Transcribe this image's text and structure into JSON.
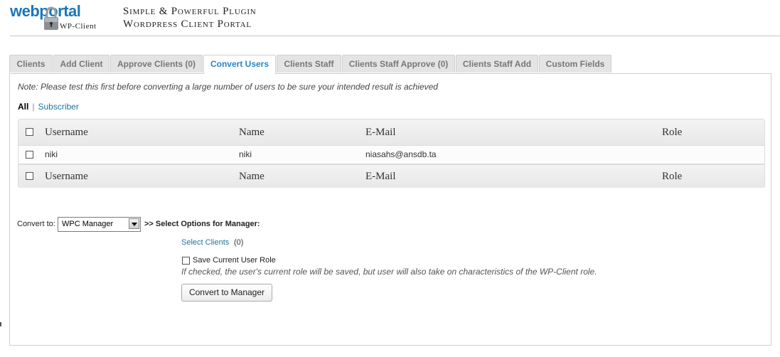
{
  "brand": {
    "logo_web": "web",
    "logo_portal": "portal",
    "logo_sub": "WP-Client",
    "tagline_line1": "Simple & Powerful Plugin",
    "tagline_line2": "Wordpress Client Portal",
    "accent_color": "#1a76b8"
  },
  "tabs": [
    {
      "label": "Clients",
      "active": false
    },
    {
      "label": "Add Client",
      "active": false
    },
    {
      "label": "Approve Clients (0)",
      "active": false
    },
    {
      "label": "Convert Users",
      "active": true
    },
    {
      "label": "Clients Staff",
      "active": false
    },
    {
      "label": "Clients Staff Approve (0)",
      "active": false
    },
    {
      "label": "Clients Staff Add",
      "active": false
    },
    {
      "label": "Custom Fields",
      "active": false
    }
  ],
  "note": "Note: Please test this first before converting a large number of users to be sure your intended result is achieved",
  "filters": {
    "all": "All",
    "separator": "|",
    "subscriber": "Subscriber"
  },
  "table": {
    "columns": [
      "Username",
      "Name",
      "E-Mail",
      "Role"
    ],
    "rows": [
      {
        "username": "niki",
        "name": "niki",
        "email": "niasahs@ansdb.ta",
        "role": ""
      }
    ]
  },
  "convert": {
    "label": "Convert to:",
    "selected": "WPC Manager",
    "options_label": ">> Select Options for Manager:",
    "select_clients": "Select Clients",
    "select_clients_count": "(0)",
    "save_role_label": "Save Current User Role",
    "save_role_note": "If checked, the user's current role will be saved, but user will also take on characteristics of the WP-Client role.",
    "button": "Convert to Manager"
  }
}
